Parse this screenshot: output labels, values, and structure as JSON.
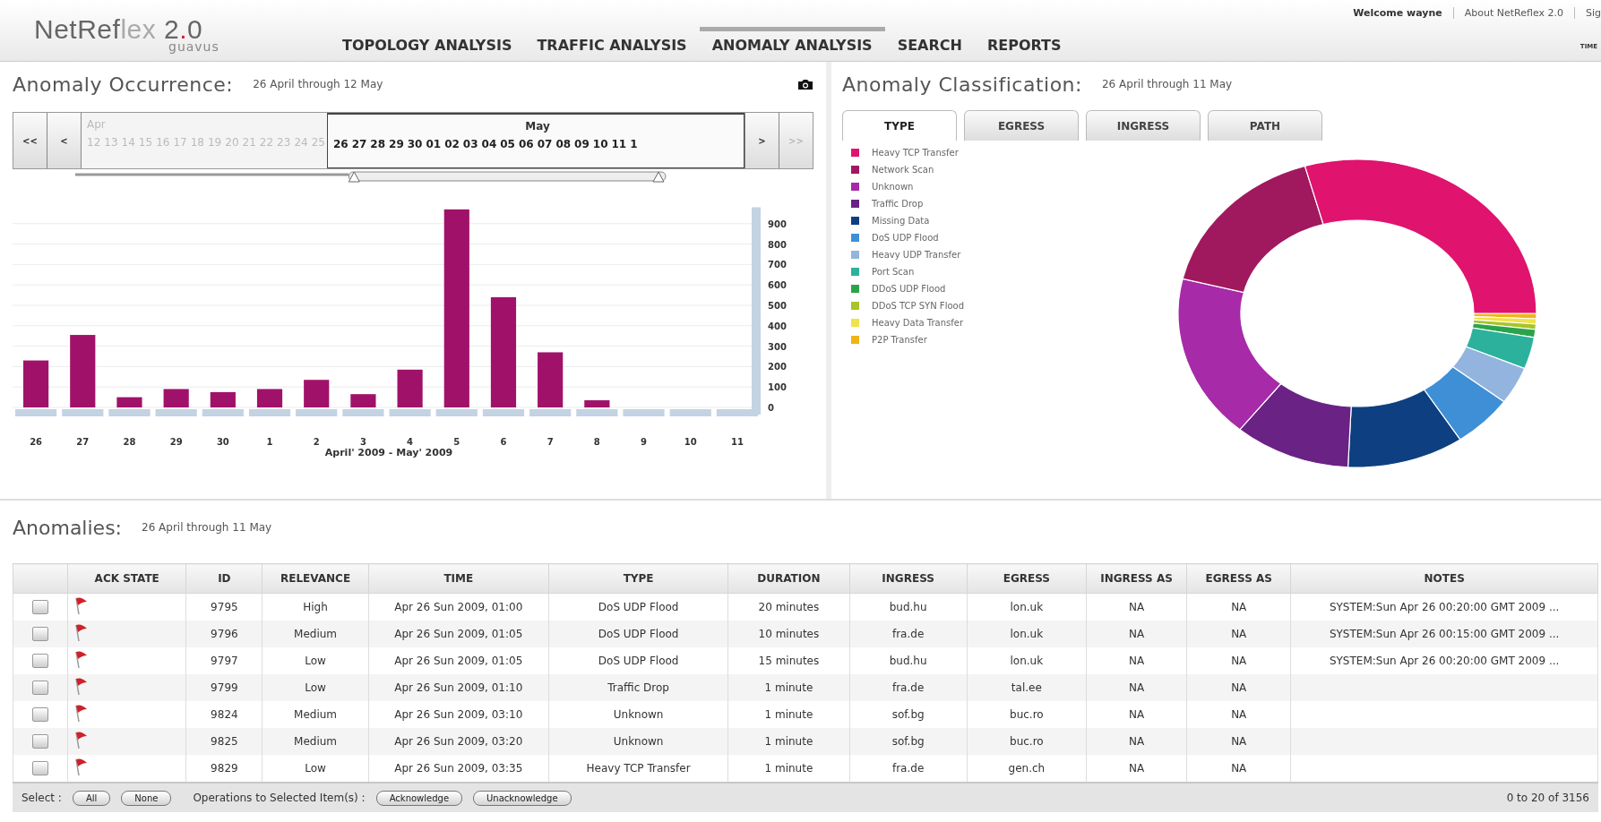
{
  "header": {
    "logo": {
      "name_dark": "NetRef",
      "name_light": "lex",
      "version_pre": "2",
      "version_dot": ".",
      "version_post": "0",
      "brand": "guavus"
    },
    "nav": [
      {
        "label": "TOPOLOGY ANALYSIS",
        "selected": false
      },
      {
        "label": "TRAFFIC ANALYSIS",
        "selected": false
      },
      {
        "label": "ANOMALY ANALYSIS",
        "selected": true
      },
      {
        "label": "SEARCH",
        "selected": false
      },
      {
        "label": "REPORTS",
        "selected": false
      }
    ],
    "welcome": "Welcome wayne",
    "links": [
      "About NetReflex 2.0",
      "Sig"
    ],
    "time_label": "TIME"
  },
  "occurrence": {
    "title": "Anomaly Occurrence:",
    "range": "26 April through 12 May",
    "timeline": {
      "slider": {
        "level": 0.54
      },
      "buttons": [
        "<<",
        "<",
        ">",
        ">>"
      ],
      "months": [
        {
          "label": "Apr",
          "selected": false
        },
        {
          "label": "May",
          "selected": true
        }
      ],
      "days": [
        {
          "label": "12",
          "selected": false
        },
        {
          "label": "13",
          "selected": false
        },
        {
          "label": "14",
          "selected": false
        },
        {
          "label": "15",
          "selected": false
        },
        {
          "label": "16",
          "selected": false
        },
        {
          "label": "17",
          "selected": false
        },
        {
          "label": "18",
          "selected": false
        },
        {
          "label": "19",
          "selected": false
        },
        {
          "label": "20",
          "selected": false
        },
        {
          "label": "21",
          "selected": false
        },
        {
          "label": "22",
          "selected": false
        },
        {
          "label": "23",
          "selected": false
        },
        {
          "label": "24",
          "selected": false
        },
        {
          "label": "25",
          "selected": false
        },
        {
          "label": "26",
          "selected": true
        },
        {
          "label": "27",
          "selected": true
        },
        {
          "label": "28",
          "selected": true
        },
        {
          "label": "29",
          "selected": true
        },
        {
          "label": "30",
          "selected": true
        },
        {
          "label": "01",
          "selected": true
        },
        {
          "label": "02",
          "selected": true
        },
        {
          "label": "03",
          "selected": true
        },
        {
          "label": "04",
          "selected": true
        },
        {
          "label": "05",
          "selected": true
        },
        {
          "label": "06",
          "selected": true
        },
        {
          "label": "07",
          "selected": true
        },
        {
          "label": "08",
          "selected": true
        },
        {
          "label": "09",
          "selected": true
        },
        {
          "label": "10",
          "selected": true
        },
        {
          "label": "11",
          "selected": true
        },
        {
          "label": "1",
          "selected": true
        }
      ]
    },
    "chart_data": {
      "type": "bar",
      "xlabel": "April' 2009 - May' 2009",
      "categories": [
        "26",
        "27",
        "28",
        "29",
        "30",
        "1",
        "2",
        "3",
        "4",
        "5",
        "6",
        "7",
        "8",
        "9",
        "10",
        "11"
      ],
      "values": [
        230,
        355,
        50,
        90,
        75,
        90,
        135,
        65,
        185,
        970,
        540,
        270,
        35,
        0,
        0,
        0
      ],
      "grid": true,
      "ylim": [
        0,
        980
      ],
      "yticks": [
        0,
        100,
        200,
        300,
        400,
        500,
        600,
        700,
        800,
        900
      ]
    }
  },
  "classification": {
    "title": "Anomaly Classification:",
    "range": "26 April through 11 May",
    "tabs": [
      {
        "label": "TYPE",
        "selected": true
      },
      {
        "label": "EGRESS",
        "selected": false
      },
      {
        "label": "INGRESS",
        "selected": false
      },
      {
        "label": "PATH",
        "selected": false
      }
    ],
    "legend": [
      {
        "label": "Heavy TCP Transfer",
        "color": "#e0136f"
      },
      {
        "label": "Network Scan",
        "color": "#a0195f"
      },
      {
        "label": "Unknown",
        "color": "#a72aa8"
      },
      {
        "label": "Traffic Drop",
        "color": "#6a2285"
      },
      {
        "label": "Missing Data",
        "color": "#0e3f80"
      },
      {
        "label": "DoS UDP Flood",
        "color": "#3f8fd6"
      },
      {
        "label": "Heavy UDP Transfer",
        "color": "#93b4de"
      },
      {
        "label": "Port Scan",
        "color": "#2cb29c"
      },
      {
        "label": "DDoS UDP Flood",
        "color": "#2aa44a"
      },
      {
        "label": "DDoS TCP SYN Flood",
        "color": "#a8c42a"
      },
      {
        "label": "Heavy Data Transfer",
        "color": "#f0e24a"
      },
      {
        "label": "P2P Transfer",
        "color": "#f0b418"
      }
    ]
  },
  "anomalies": {
    "title": "Anomalies:",
    "range": "26 April through 11 May",
    "columns": [
      "",
      "ACK STATE",
      "ID",
      "RELEVANCE",
      "TIME",
      "TYPE",
      "DURATION",
      "INGRESS",
      "EGRESS",
      "INGRESS AS",
      "EGRESS AS",
      "NOTES"
    ],
    "rows": [
      {
        "checked": false,
        "cells": [
          "",
          "",
          "9795",
          "High",
          "Apr 26 Sun 2009, 01:00",
          "DoS UDP Flood",
          "20 minutes",
          "bud.hu",
          "lon.uk",
          "NA",
          "NA",
          "SYSTEM:Sun Apr 26 00:20:00 GMT 2009 ..."
        ]
      },
      {
        "checked": false,
        "cells": [
          "",
          "",
          "9796",
          "Medium",
          "Apr 26 Sun 2009, 01:05",
          "DoS UDP Flood",
          "10 minutes",
          "fra.de",
          "lon.uk",
          "NA",
          "NA",
          "SYSTEM:Sun Apr 26 00:15:00 GMT 2009 ..."
        ]
      },
      {
        "checked": false,
        "cells": [
          "",
          "",
          "9797",
          "Low",
          "Apr 26 Sun 2009, 01:05",
          "DoS UDP Flood",
          "15 minutes",
          "bud.hu",
          "lon.uk",
          "NA",
          "NA",
          "SYSTEM:Sun Apr 26 00:20:00 GMT 2009 ..."
        ]
      },
      {
        "checked": false,
        "cells": [
          "",
          "",
          "9799",
          "Low",
          "Apr 26 Sun 2009, 01:10",
          "Traffic Drop",
          "1 minute",
          "fra.de",
          "tal.ee",
          "NA",
          "NA"
        ]
      },
      {
        "checked": false,
        "cells": [
          "",
          "",
          "9824",
          "Medium",
          "Apr 26 Sun 2009, 03:10",
          "Unknown",
          "1 minute",
          "sof.bg",
          "buc.ro",
          "NA",
          "NA"
        ]
      },
      {
        "checked": false,
        "cells": [
          "",
          "",
          "9825",
          "Medium",
          "Apr 26 Sun 2009, 03:20",
          "Unknown",
          "1 minute",
          "sof.bg",
          "buc.ro",
          "NA",
          "NA"
        ]
      },
      {
        "checked": false,
        "cells": [
          "",
          "",
          "9829",
          "Low",
          "Apr 26 Sun 2009, 03:35",
          "Heavy TCP Transfer",
          "1 minute",
          "fra.de",
          "gen.ch",
          "NA",
          "NA"
        ]
      }
    ],
    "footer": {
      "select_label": "Select :",
      "select_buttons": [
        "All",
        "None"
      ],
      "ops_label": "Operations to Selected Item(s) :",
      "op_buttons": [
        "Acknowledge",
        "Unacknowledge"
      ],
      "count": "0 to 20 of 3156"
    }
  }
}
